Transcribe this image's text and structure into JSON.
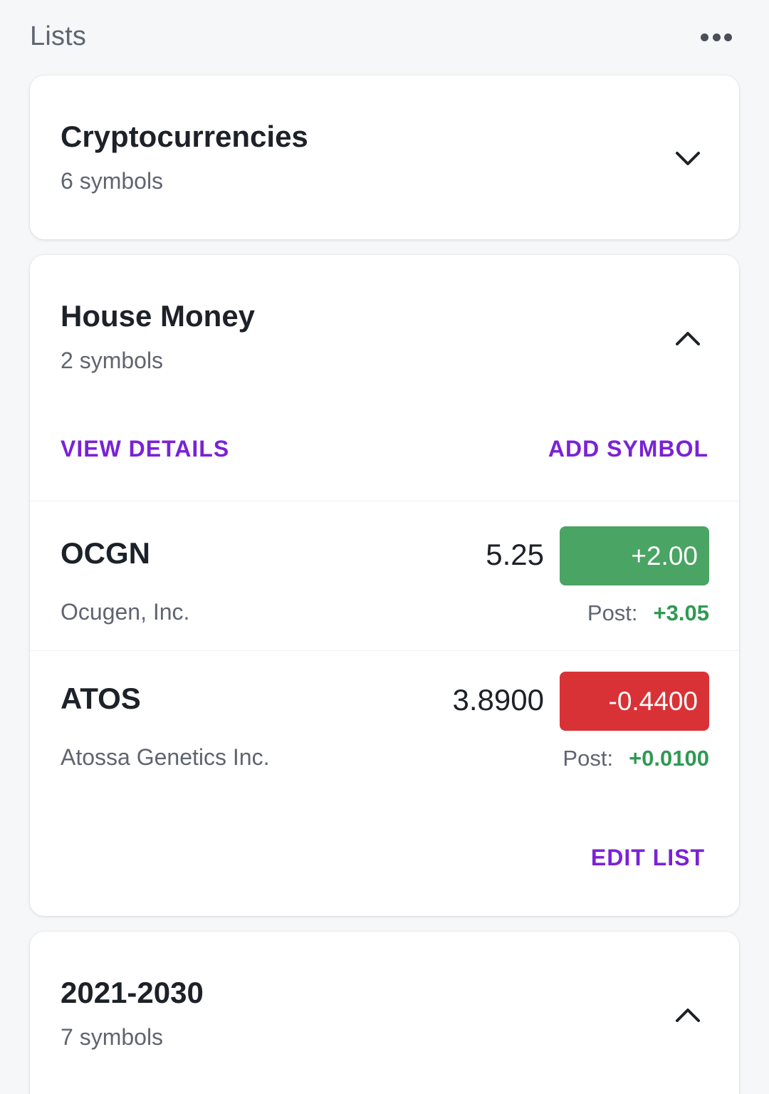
{
  "header": {
    "title": "Lists",
    "more_icon": "more-horizontal-icon"
  },
  "colors": {
    "accent": "#7a22d6",
    "positive": "#2e9a52",
    "positive_badge": "#4aa463",
    "negative_badge": "#d93236"
  },
  "lists": [
    {
      "name": "Cryptocurrencies",
      "count_label": "6 symbols",
      "expanded": false,
      "chevron_icon": "chevron-down-icon"
    },
    {
      "name": "House Money",
      "count_label": "2 symbols",
      "expanded": true,
      "chevron_icon": "chevron-up-icon",
      "view_details_label": "VIEW DETAILS",
      "add_symbol_label": "ADD SYMBOL",
      "edit_list_label": "EDIT LIST",
      "quotes": [
        {
          "symbol": "OCGN",
          "company": "Ocugen, Inc.",
          "price": "5.25",
          "change": "+2.00",
          "direction": "up",
          "post_label": "Post:",
          "post_change": "+3.05"
        },
        {
          "symbol": "ATOS",
          "company": "Atossa Genetics Inc.",
          "price": "3.8900",
          "change": "-0.4400",
          "direction": "down",
          "post_label": "Post:",
          "post_change": "+0.0100"
        }
      ]
    },
    {
      "name": "2021-2030",
      "count_label": "7 symbols",
      "expanded": true,
      "chevron_icon": "chevron-up-icon"
    }
  ]
}
